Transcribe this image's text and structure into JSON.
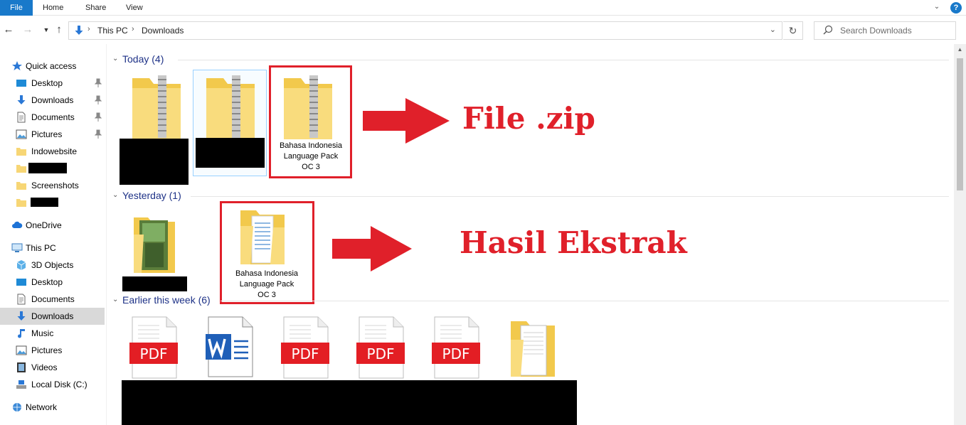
{
  "ribbon": {
    "tabs": [
      "File",
      "Home",
      "Share",
      "View"
    ],
    "help_label": "?"
  },
  "address": {
    "crumbs": [
      "This PC",
      "Downloads"
    ],
    "search_placeholder": "Search Downloads"
  },
  "sidebar": {
    "quick_access": "Quick access",
    "quick_items": [
      "Desktop",
      "Downloads",
      "Documents",
      "Pictures",
      "Indowebsite",
      "",
      "Screenshots",
      ""
    ],
    "onedrive": "OneDrive",
    "this_pc": "This PC",
    "pc_items": [
      "3D Objects",
      "Desktop",
      "Documents",
      "Downloads",
      "Music",
      "Pictures",
      "Videos",
      "Local Disk (C:)"
    ],
    "network": "Network",
    "active_item": "Downloads"
  },
  "groups": {
    "today": "Today (4)",
    "yesterday": "Yesterday (1)",
    "earlier": "Earlier this week (6)"
  },
  "files": {
    "zip_name_line1": "Bahasa Indonesia",
    "zip_name_line2": "Language Pack",
    "zip_name_line3": "OC 3",
    "folder_name_line1": "Bahasa Indonesia",
    "folder_name_line2": "Language Pack",
    "folder_name_line3": "OC 3",
    "pdf_badge": "PDF"
  },
  "annotations": {
    "zip_label": "File .zip",
    "extract_label": "Hasil Ekstrak",
    "color": "#e0202a"
  },
  "colors": {
    "accent": "#1979ca",
    "group_title": "#1e3287",
    "folder": "#f7d675",
    "pdf_red": "#e31e24"
  }
}
